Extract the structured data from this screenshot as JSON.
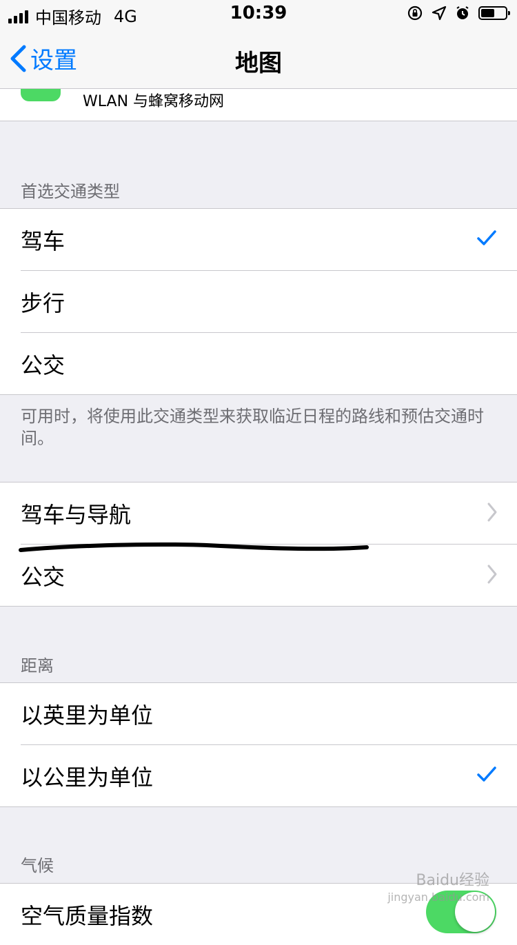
{
  "status": {
    "carrier": "中国移动",
    "network": "4G",
    "time": "10:39",
    "battery_level": 0.55
  },
  "nav": {
    "back_label": "设置",
    "title": "地图"
  },
  "top_partial": {
    "label": "WLAN 与蜂窝移动网"
  },
  "transport": {
    "header": "首选交通类型",
    "items": [
      {
        "label": "驾车",
        "checked": true
      },
      {
        "label": "步行",
        "checked": false
      },
      {
        "label": "公交",
        "checked": false
      }
    ],
    "footer": "可用时，将使用此交通类型来获取临近日程的路线和预估交通时间。"
  },
  "nav_section": {
    "items": [
      {
        "label": "驾车与导航"
      },
      {
        "label": "公交"
      }
    ]
  },
  "distance": {
    "header": "距离",
    "items": [
      {
        "label": "以英里为单位",
        "checked": false
      },
      {
        "label": "以公里为单位",
        "checked": true
      }
    ]
  },
  "climate": {
    "header": "气候",
    "items": [
      {
        "label": "空气质量指数",
        "toggle_on": true
      }
    ]
  },
  "watermark": {
    "line1": "Baidu经验",
    "line2": "jingyan.baidu.com"
  },
  "colors": {
    "accent": "#007aff",
    "toggle_on": "#4cd964",
    "background": "#efeff4"
  }
}
